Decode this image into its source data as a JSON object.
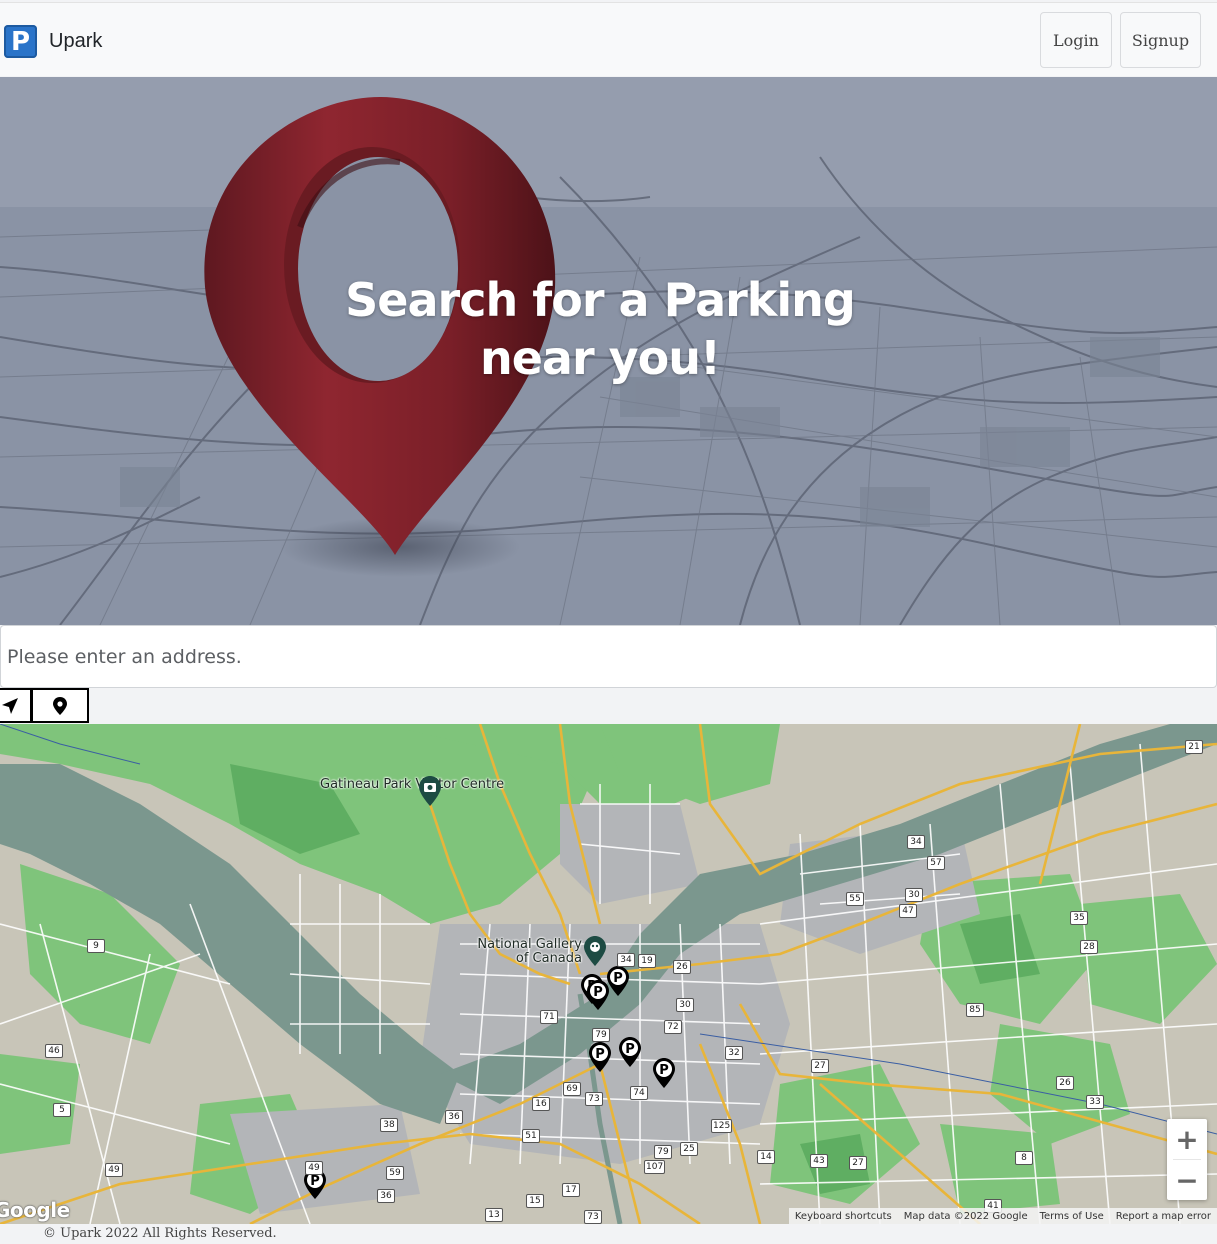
{
  "navbar": {
    "logo_letter": "P",
    "brand": "Upark",
    "login_label": "Login",
    "signup_label": "Signup"
  },
  "hero": {
    "title": "Search for a Parking near you!"
  },
  "search": {
    "placeholder": "Please enter an address."
  },
  "map": {
    "places": [
      {
        "name": "Gatineau Park Visitor Centre"
      },
      {
        "name": "National Gallery of Canada"
      }
    ],
    "routes": [
      "21",
      "34",
      "57",
      "55",
      "30",
      "47",
      "35",
      "28",
      "9",
      "19",
      "26",
      "34",
      "30",
      "71",
      "72",
      "79",
      "32",
      "27",
      "85",
      "46",
      "69",
      "73",
      "74",
      "26",
      "33",
      "5",
      "36",
      "38",
      "16",
      "51",
      "125",
      "79",
      "107",
      "25",
      "14",
      "43",
      "27",
      "8",
      "49",
      "59",
      "36",
      "15",
      "17",
      "13",
      "73",
      "41",
      "49"
    ],
    "zoom_in": "+",
    "zoom_out": "−",
    "google_logo": "Google",
    "attribution": {
      "keyboard": "Keyboard shortcuts",
      "data": "Map data ©2022 Google",
      "terms": "Terms of Use",
      "report": "Report a map error"
    }
  },
  "footer": {
    "text": "© Upark 2022 All Rights Reserved."
  }
}
